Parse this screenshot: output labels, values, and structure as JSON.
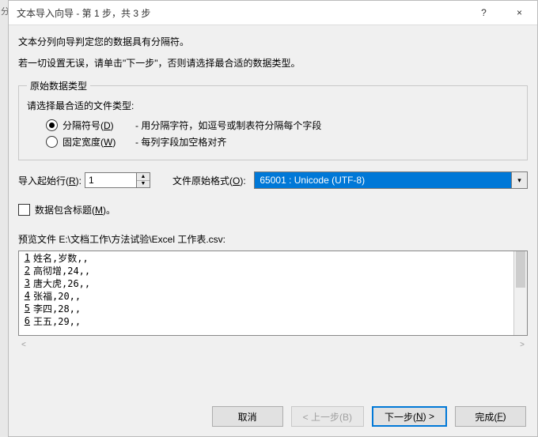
{
  "left_strip": "分",
  "title": "文本导入向导 - 第 1 步，共 3 步",
  "help_symbol": "?",
  "close_symbol": "×",
  "intro1": "文本分列向导判定您的数据具有分隔符。",
  "intro2": "若一切设置无误，请单击\"下一步\"，否则请选择最合适的数据类型。",
  "group_legend": "原始数据类型",
  "prompt": "请选择最合适的文件类型:",
  "radios": [
    {
      "label_pre": "分隔符号(",
      "key": "D",
      "label_post": ")",
      "desc": "- 用分隔字符，如逗号或制表符分隔每个字段",
      "checked": true
    },
    {
      "label_pre": "固定宽度(",
      "key": "W",
      "label_post": ")",
      "desc": "- 每列字段加空格对齐",
      "checked": false
    }
  ],
  "origin_label_pre": "导入起始行(",
  "origin_key": "R",
  "origin_label_post": "):",
  "origin_value": "1",
  "encoding_label_pre": "文件原始格式(",
  "encoding_key": "O",
  "encoding_label_post": "):",
  "encoding_value": "65001 : Unicode (UTF-8)",
  "checkbox_pre": "数据包含标题(",
  "checkbox_key": "M",
  "checkbox_post": ")。",
  "preview_label": "预览文件 E:\\文档工作\\方法试验\\Excel 工作表.csv:",
  "preview_lines": [
    {
      "n": "1",
      "t": "姓名,岁数,,"
    },
    {
      "n": "2",
      "t": "高彻增,24,,"
    },
    {
      "n": "3",
      "t": "唐大虎,26,,"
    },
    {
      "n": "4",
      "t": "张福,20,,"
    },
    {
      "n": "5",
      "t": "李四,28,,"
    },
    {
      "n": "6",
      "t": "王五,29,,"
    }
  ],
  "hscroll_left": "<",
  "hscroll_right": ">",
  "buttons": {
    "cancel": "取消",
    "back": "< 上一步(B)",
    "next_pre": "下一步(",
    "next_key": "N",
    "next_post": ") >",
    "finish_pre": "完成(",
    "finish_key": "F",
    "finish_post": ")"
  }
}
